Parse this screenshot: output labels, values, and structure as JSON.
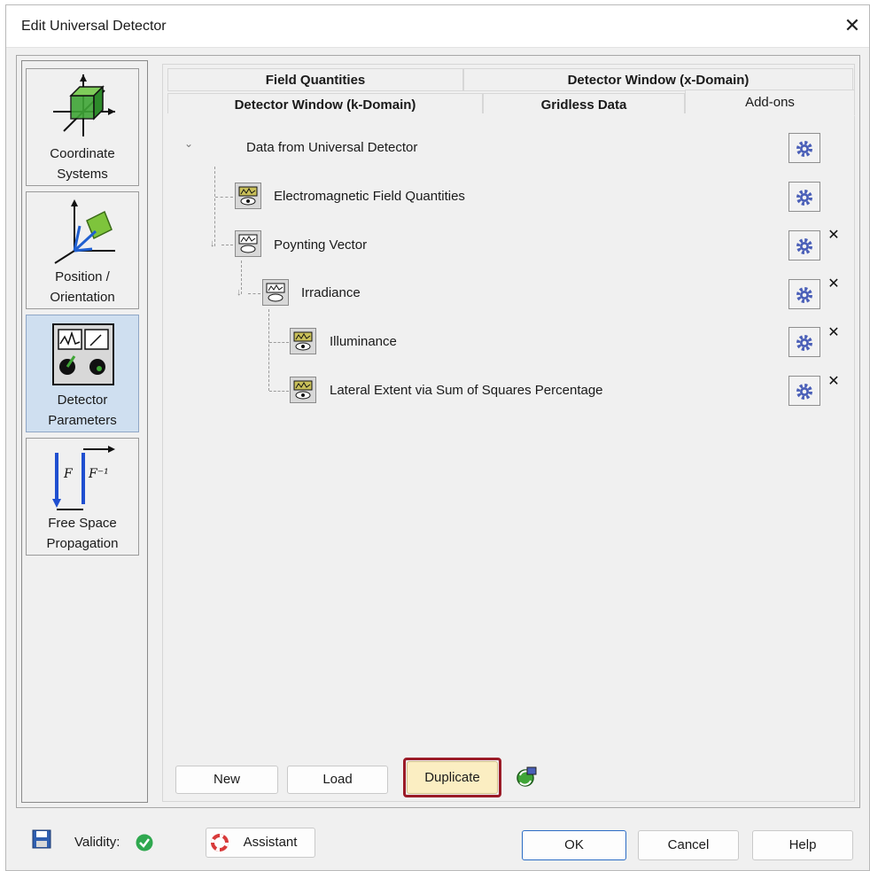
{
  "window": {
    "title": "Edit Universal Detector",
    "close_symbol": "✕"
  },
  "sidebar": {
    "items": [
      {
        "label_line1": "Coordinate",
        "label_line2": "Systems",
        "icon": "coordinate-systems-icon",
        "active": false
      },
      {
        "label_line1": "Position /",
        "label_line2": "Orientation",
        "icon": "position-orientation-icon",
        "active": false
      },
      {
        "label_line1": "Detector",
        "label_line2": "Parameters",
        "icon": "detector-parameters-icon",
        "active": true
      },
      {
        "label_line1": "Free Space",
        "label_line2": "Propagation",
        "icon": "free-space-propagation-icon",
        "active": false
      }
    ]
  },
  "tabs": {
    "row1": [
      "Field Quantities",
      "Detector Window (x-Domain)"
    ],
    "row2": [
      "Detector Window (k-Domain)",
      "Gridless Data",
      "Add-ons"
    ],
    "active": "Add-ons"
  },
  "tree": {
    "root": {
      "label": "Data from Universal Detector",
      "chevron": "⌄"
    },
    "nodes": [
      {
        "label": "Electromagnetic Field Quantities",
        "level": 1,
        "deletable": false
      },
      {
        "label": "Poynting Vector",
        "level": 1,
        "deletable": true
      },
      {
        "label": "Irradiance",
        "level": 2,
        "deletable": true
      },
      {
        "label": "Illuminance",
        "level": 3,
        "deletable": true
      },
      {
        "label": "Lateral Extent via Sum of Squares Percentage",
        "level": 3,
        "deletable": true
      }
    ],
    "delete_symbol": "✕"
  },
  "panel_buttons": {
    "new": "New",
    "load": "Load",
    "duplicate": "Duplicate"
  },
  "footer": {
    "validity_label": "Validity:",
    "assistant": "Assistant",
    "ok": "OK",
    "cancel": "Cancel",
    "help": "Help"
  },
  "colors": {
    "gear": "#4a5fb8",
    "highlight_frame": "#9b1b27",
    "duplicate_bg": "#fbeec2",
    "active_side": "#cfdff0",
    "validity_ok": "#2fa84f"
  }
}
